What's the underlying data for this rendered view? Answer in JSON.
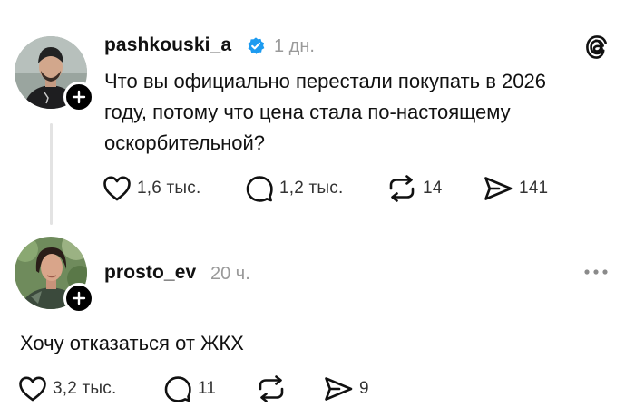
{
  "posts": [
    {
      "username": "pashkouski_a",
      "verified": true,
      "time": "1 дн.",
      "text_lines": [
        "Что вы официально перестали покупать в 2026",
        "году, потому что цена стала по-настоящему",
        "оскорбительной?"
      ],
      "likes": "1,6 тыс.",
      "replies": "1,2 тыс.",
      "reposts": "14",
      "shares": "141"
    },
    {
      "username": "prosto_ev",
      "verified": false,
      "time": "20 ч.",
      "text": "Хочу отказаться от ЖКХ",
      "likes": "3,2 тыс.",
      "replies": "11",
      "reposts": "",
      "shares": "9"
    }
  ],
  "icons": {
    "brand": "threads-logo-icon",
    "verified": "verified-badge-icon",
    "like": "heart-icon",
    "reply": "speech-bubble-icon",
    "repost": "repost-arrows-icon",
    "share": "send-icon",
    "more": "more-dots-icon",
    "follow": "plus-icon"
  },
  "colors": {
    "verified_badge": "#1d9bf0",
    "text": "#111111",
    "muted": "#9a9a9a",
    "thread_line": "#e3e3e3"
  }
}
